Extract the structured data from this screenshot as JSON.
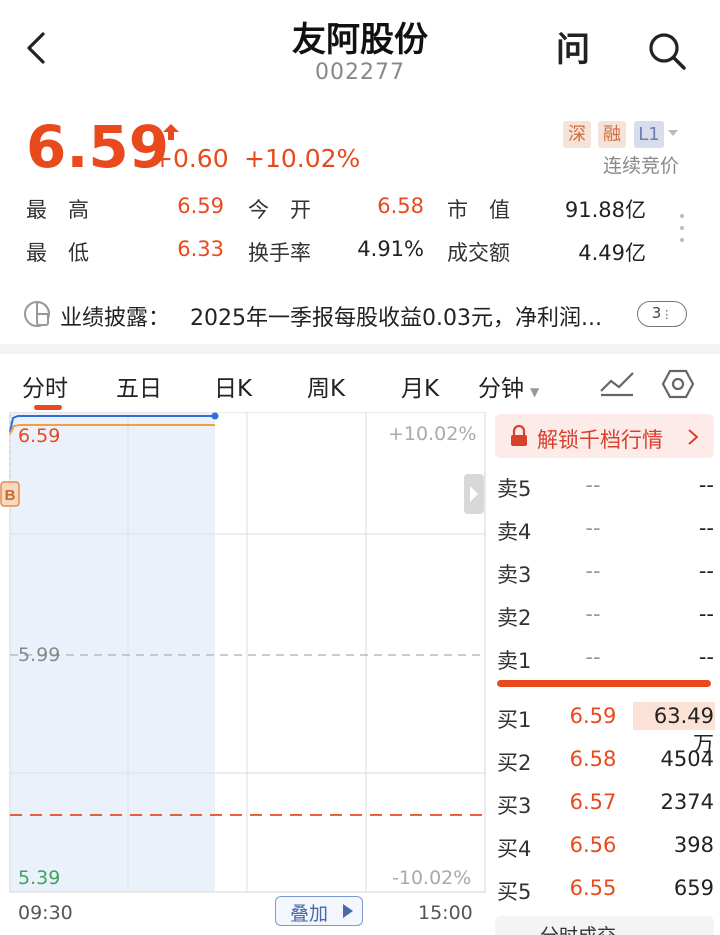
{
  "header": {
    "title": "友阿股份",
    "code": "002277",
    "ask_icon_label": "问"
  },
  "quote": {
    "price": "6.59",
    "change": "+0.60",
    "change_pct": "+10.02%",
    "tags": {
      "market": "深",
      "margin": "融",
      "level": "L1"
    },
    "mode": "连续竞价"
  },
  "stats": [
    {
      "label": "最　高",
      "value": "6.59",
      "red": true
    },
    {
      "label": "今　开",
      "value": "6.58",
      "red": true
    },
    {
      "label": "市　值",
      "value": "91.88亿",
      "red": false
    },
    {
      "label": "最　低",
      "value": "6.33",
      "red": true
    },
    {
      "label": "换手率",
      "value": "4.91%",
      "red": false
    },
    {
      "label": "成交额",
      "value": "4.49亿",
      "red": false
    }
  ],
  "announcement": {
    "label": "业绩披露：",
    "text": "2025年一季报每股收益0.03元，净利润...",
    "count": "3"
  },
  "tabs": [
    "分时",
    "五日",
    "日K",
    "周K",
    "月K",
    "分钟"
  ],
  "chart": {
    "y_top": "6.59",
    "y_mid": "5.99",
    "y_bot": "5.39",
    "pct_top": "+10.02%",
    "pct_bot": "-10.02%",
    "x_start": "09:30",
    "x_end": "15:00",
    "overlay_label": "叠加",
    "b_marker": "B"
  },
  "orderbook": {
    "unlock_label": "解锁千档行情",
    "asks": [
      {
        "label": "卖5",
        "price": "--",
        "volume": "--"
      },
      {
        "label": "卖4",
        "price": "--",
        "volume": "--"
      },
      {
        "label": "卖3",
        "price": "--",
        "volume": "--"
      },
      {
        "label": "卖2",
        "price": "--",
        "volume": "--"
      },
      {
        "label": "卖1",
        "price": "--",
        "volume": "--"
      }
    ],
    "bids": [
      {
        "label": "买1",
        "price": "6.59",
        "volume": "63.49万"
      },
      {
        "label": "买2",
        "price": "6.58",
        "volume": "4504"
      },
      {
        "label": "买3",
        "price": "6.57",
        "volume": "2374"
      },
      {
        "label": "买4",
        "price": "6.56",
        "volume": "398"
      },
      {
        "label": "买5",
        "price": "6.55",
        "volume": "659"
      }
    ],
    "tick_tab_label": "分时成交"
  },
  "colors": {
    "up": "#e8491d",
    "line": "#2e6fd6",
    "avg": "#f0a040"
  }
}
